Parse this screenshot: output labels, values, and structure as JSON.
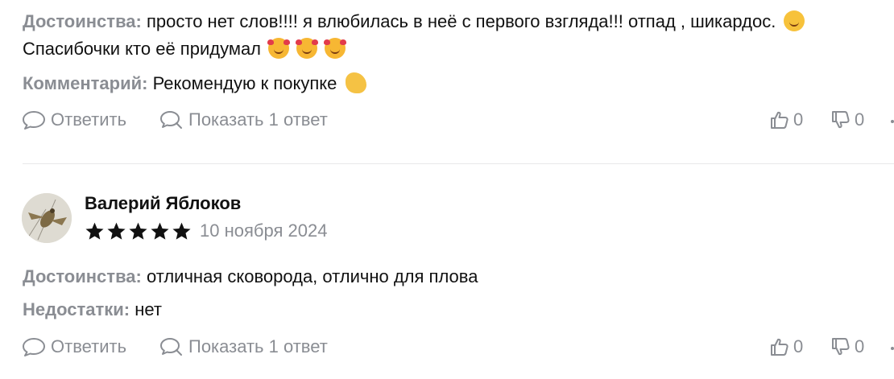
{
  "review1": {
    "pros_label": "Достоинства:",
    "pros_text_1": " просто нет слов!!!! я влюбилась в неё с первого взгляда!!! отпад , шикардос.",
    "pros_text_2": "Спасибочки кто её придумал",
    "comment_label": "Комментарий:",
    "comment_text": " Рекомендую к покупке",
    "reply_label": "Ответить",
    "show_reply_label": "Показать 1 ответ",
    "likes": "0",
    "dislikes": "0"
  },
  "review2": {
    "author": "Валерий Яблоков",
    "rating": 5,
    "date": "10 ноября 2024",
    "pros_label": "Достоинства:",
    "pros_text": " отличная сковорода, отлично для плова",
    "cons_label": "Недостатки:",
    "cons_text": " нет",
    "reply_label": "Ответить",
    "show_reply_label": "Показать 1 ответ",
    "likes": "0",
    "dislikes": "0"
  },
  "icons": {
    "reply": "speech-bubble-icon",
    "show_replies": "search-bubble-icon",
    "like": "thumbs-up-icon",
    "dislike": "thumbs-down-icon",
    "star": "star-icon",
    "emojis": [
      "zany-face-emoji",
      "smiling-face-with-hearts-emoji",
      "flexed-biceps-emoji"
    ]
  },
  "colors": {
    "muted": "#8a8d93",
    "text": "#111111",
    "divider": "#e8e8ea"
  }
}
